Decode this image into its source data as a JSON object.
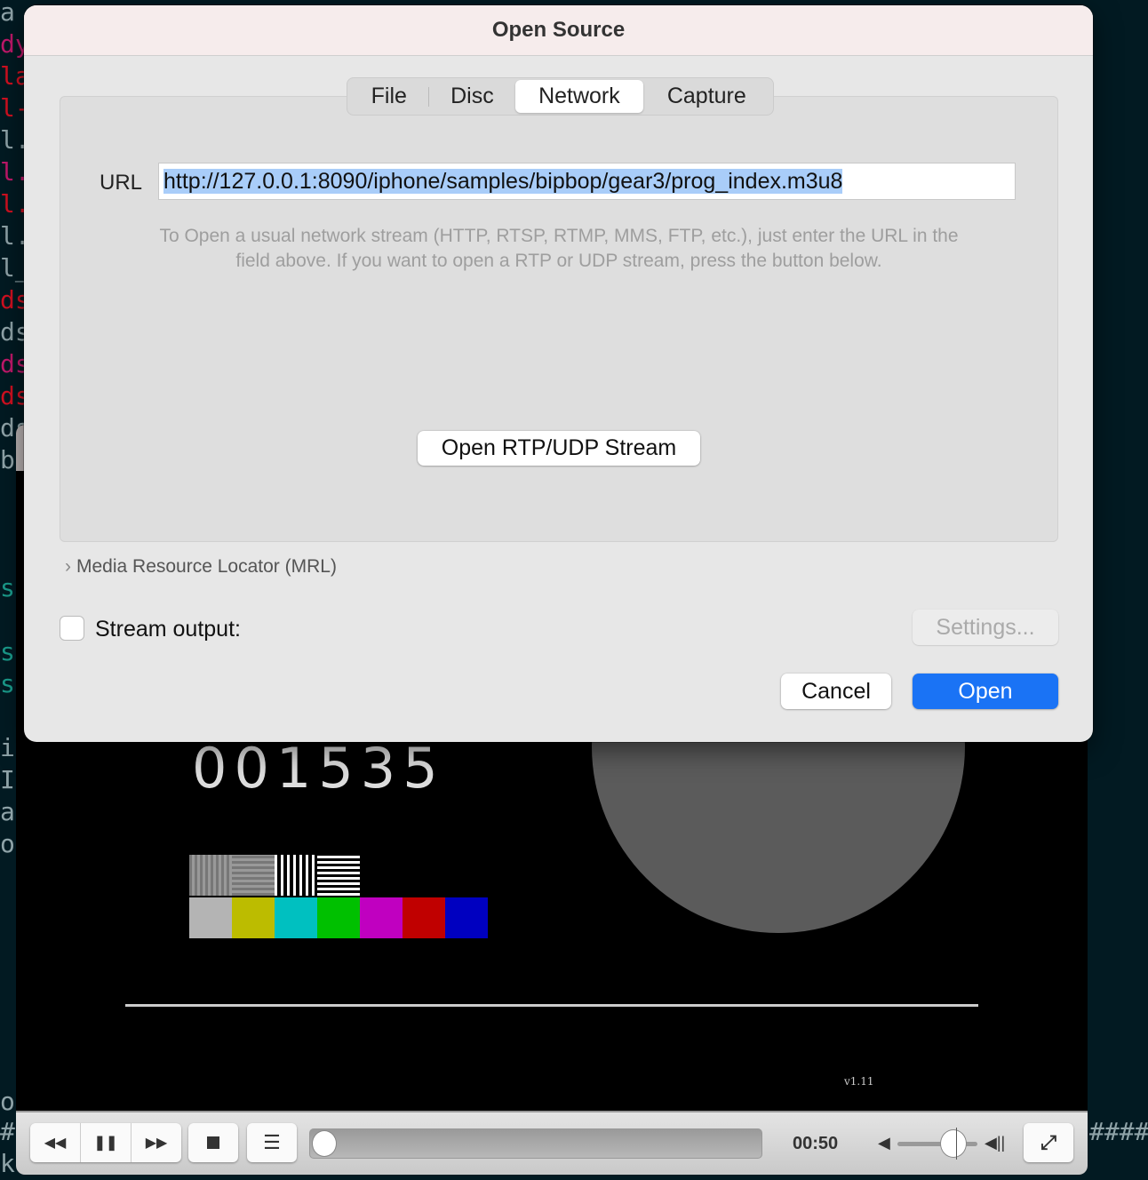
{
  "background_terminal": {
    "left_fragments": [
      "a",
      "dy",
      "la",
      "l-",
      "l.",
      "l.",
      "l.",
      "l.",
      "l_",
      "ds",
      "ds",
      "ds",
      "ds",
      "ds",
      "b",
      "s",
      "s",
      "s",
      "i",
      "I",
      "a",
      "o",
      "o",
      "#",
      "k"
    ],
    "right_fragment": "####"
  },
  "player": {
    "video": {
      "frame_counter": "001535",
      "version_label": "v1.11",
      "color_bars": [
        "#b4b4b4",
        "#bcbc00",
        "#00c0c0",
        "#00c000",
        "#c000c0",
        "#c00000",
        "#0000c0"
      ]
    },
    "controls": {
      "time": "00:50",
      "seek_progress": 0.0,
      "volume_level": 0.7,
      "icons": [
        "rewind-icon",
        "pause-icon",
        "fast-forward-icon",
        "stop-icon",
        "playlist-icon",
        "volume-mute-icon",
        "volume-max-icon",
        "fullscreen-icon"
      ]
    }
  },
  "dialog": {
    "title": "Open Source",
    "tabs": [
      {
        "label": "File"
      },
      {
        "label": "Disc"
      },
      {
        "label": "Network",
        "selected": true
      },
      {
        "label": "Capture"
      }
    ],
    "url_label": "URL",
    "url_value": "http://127.0.0.1:8090/iphone/samples/bipbop/gear3/prog_index.m3u8",
    "hint_line1": "To Open a usual network stream (HTTP, RTSP, RTMP, MMS, FTP, etc.), just enter the URL in the",
    "hint_line2": "field above. If you want to open a RTP or UDP stream, press the button below.",
    "rtp_button": "Open RTP/UDP Stream",
    "mrl_label": "Media Resource Locator (MRL)",
    "stream_output_label": "Stream output:",
    "stream_output_checked": false,
    "settings_button": "Settings...",
    "cancel_button": "Cancel",
    "open_button": "Open",
    "accent_color": "#1a73f5"
  }
}
